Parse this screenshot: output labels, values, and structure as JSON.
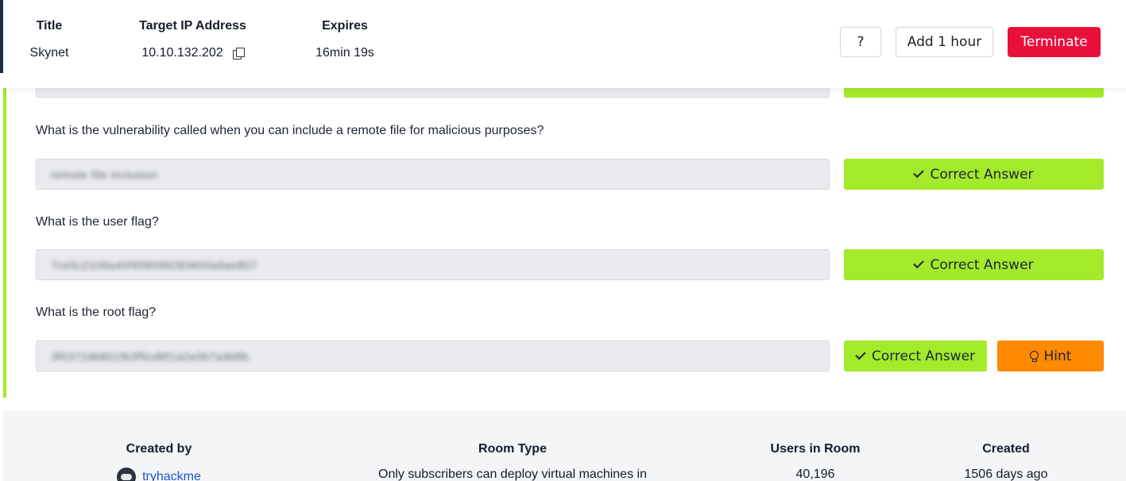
{
  "machine": {
    "title_label": "Title",
    "title_value": "Skynet",
    "ip_label": "Target IP Address",
    "ip_value": "10.10.132.202",
    "expires_label": "Expires",
    "expires_value": "16min 19s",
    "help_label": "?",
    "add_hour_label": "Add 1 hour",
    "terminate_label": "Terminate"
  },
  "questions": [
    {
      "text": "What is the vulnerability called when you can include a remote file for malicious purposes?",
      "answer": "remote file inclusion",
      "button": "Correct Answer"
    },
    {
      "text": "What is the user flag?",
      "answer": "7ce5c2109a40f958099283600a9ae807",
      "button": "Correct Answer"
    },
    {
      "text": "What is the root flag?",
      "answer": "3f0372db801fb3f5cd6f1a2e0b7a4b8b",
      "button": "Correct Answer",
      "hint_label": "Hint"
    }
  ],
  "room": {
    "created_by_label": "Created by",
    "creator": "tryhackme",
    "room_type_label": "Room Type",
    "room_type_value": "Only subscribers can deploy virtual machines in",
    "users_label": "Users in Room",
    "users_value": "40,196",
    "created_label": "Created",
    "created_value": "1506 days ago"
  },
  "colors": {
    "accent_green": "#a3ea2a",
    "terminate_red": "#e8103b",
    "hint_orange": "#ff8a00",
    "link_blue": "#1a56d6"
  }
}
